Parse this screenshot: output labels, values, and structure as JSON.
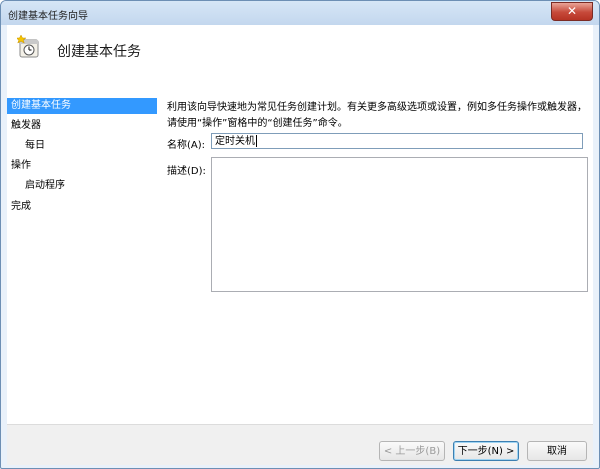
{
  "window": {
    "title": "创建基本任务向导",
    "close_glyph": "✕"
  },
  "header": {
    "title": "创建基本任务",
    "icon": "task-scheduler-clock-icon"
  },
  "nav": {
    "items": [
      {
        "label": "创建基本任务",
        "active": true
      },
      {
        "label": "触发器",
        "active": false
      },
      {
        "label": "每日",
        "active": false
      },
      {
        "label": "操作",
        "active": false
      },
      {
        "label": "启动程序",
        "active": false
      },
      {
        "label": "完成",
        "active": false
      }
    ]
  },
  "main": {
    "description": "利用该向导快速地为常见任务创建计划。有关更多高级选项或设置，例如多任务操作或触发器，请使用“操作”窗格中的“创建任务”命令。",
    "name_label": "名称(A):",
    "name_value": "定时关机",
    "desc_label": "描述(D):",
    "desc_value": ""
  },
  "buttons": {
    "back": "< 上一步(B)",
    "next": "下一步(N) >",
    "cancel": "取消"
  },
  "colors": {
    "accent": "#3399ff",
    "title_bar": "#c3d7ee",
    "close": "#c6493a"
  }
}
